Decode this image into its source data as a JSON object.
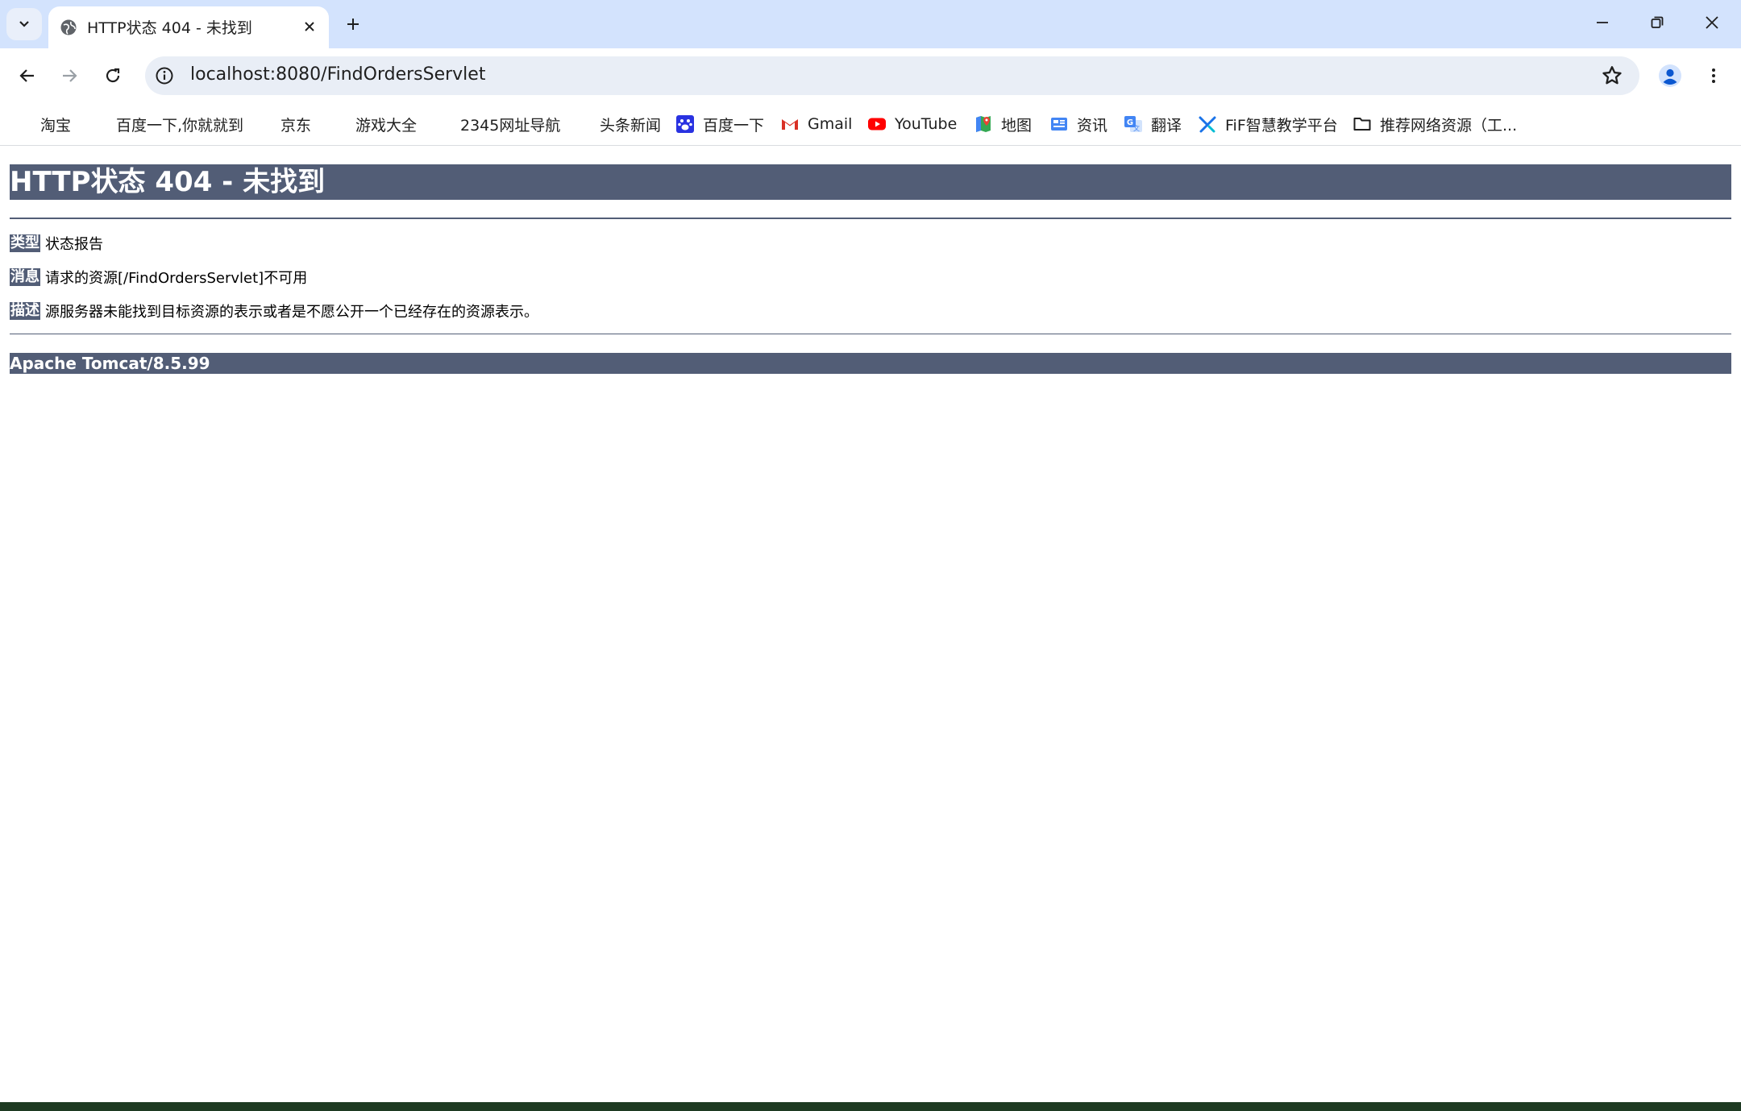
{
  "browser": {
    "tab": {
      "title": "HTTP状态 404 - 未找到"
    },
    "address_bar": {
      "url": "localhost:8080/FindOrdersServlet"
    },
    "bookmarks": [
      {
        "label": "淘宝",
        "icon": "none"
      },
      {
        "label": "百度一下,你就就到",
        "icon": "none"
      },
      {
        "label": "京东",
        "icon": "none"
      },
      {
        "label": "游戏大全",
        "icon": "none"
      },
      {
        "label": "2345网址导航",
        "icon": "none"
      },
      {
        "label": "头条新闻",
        "icon": "none"
      },
      {
        "label": "百度一下",
        "icon": "baidu-paw-icon"
      },
      {
        "label": "Gmail",
        "icon": "gmail-icon"
      },
      {
        "label": "YouTube",
        "icon": "youtube-icon"
      },
      {
        "label": "地图",
        "icon": "maps-icon"
      },
      {
        "label": "资讯",
        "icon": "news-icon"
      },
      {
        "label": "翻译",
        "icon": "translate-icon"
      },
      {
        "label": "FiF智慧教学平台",
        "icon": "fif-icon"
      },
      {
        "label": "推荐网络资源（工...",
        "icon": "folder-icon"
      }
    ],
    "colors": {
      "tabstrip": "#d3e3fd",
      "omnibox": "#e9eef6",
      "accent": "#0b57d0"
    }
  },
  "page": {
    "heading": "HTTP状态 404 - 未找到",
    "rows": [
      {
        "label": "类型",
        "value": "状态报告"
      },
      {
        "label": "消息",
        "value": "请求的资源[/FindOrdersServlet]不可用"
      },
      {
        "label": "描述",
        "value": "源服务器未能找到目标资源的表示或者是不愿公开一个已经存在的资源表示。"
      }
    ],
    "footer": "Apache Tomcat/8.5.99",
    "colors": {
      "header_bg": "#525d76",
      "header_text": "#ffffff"
    }
  }
}
